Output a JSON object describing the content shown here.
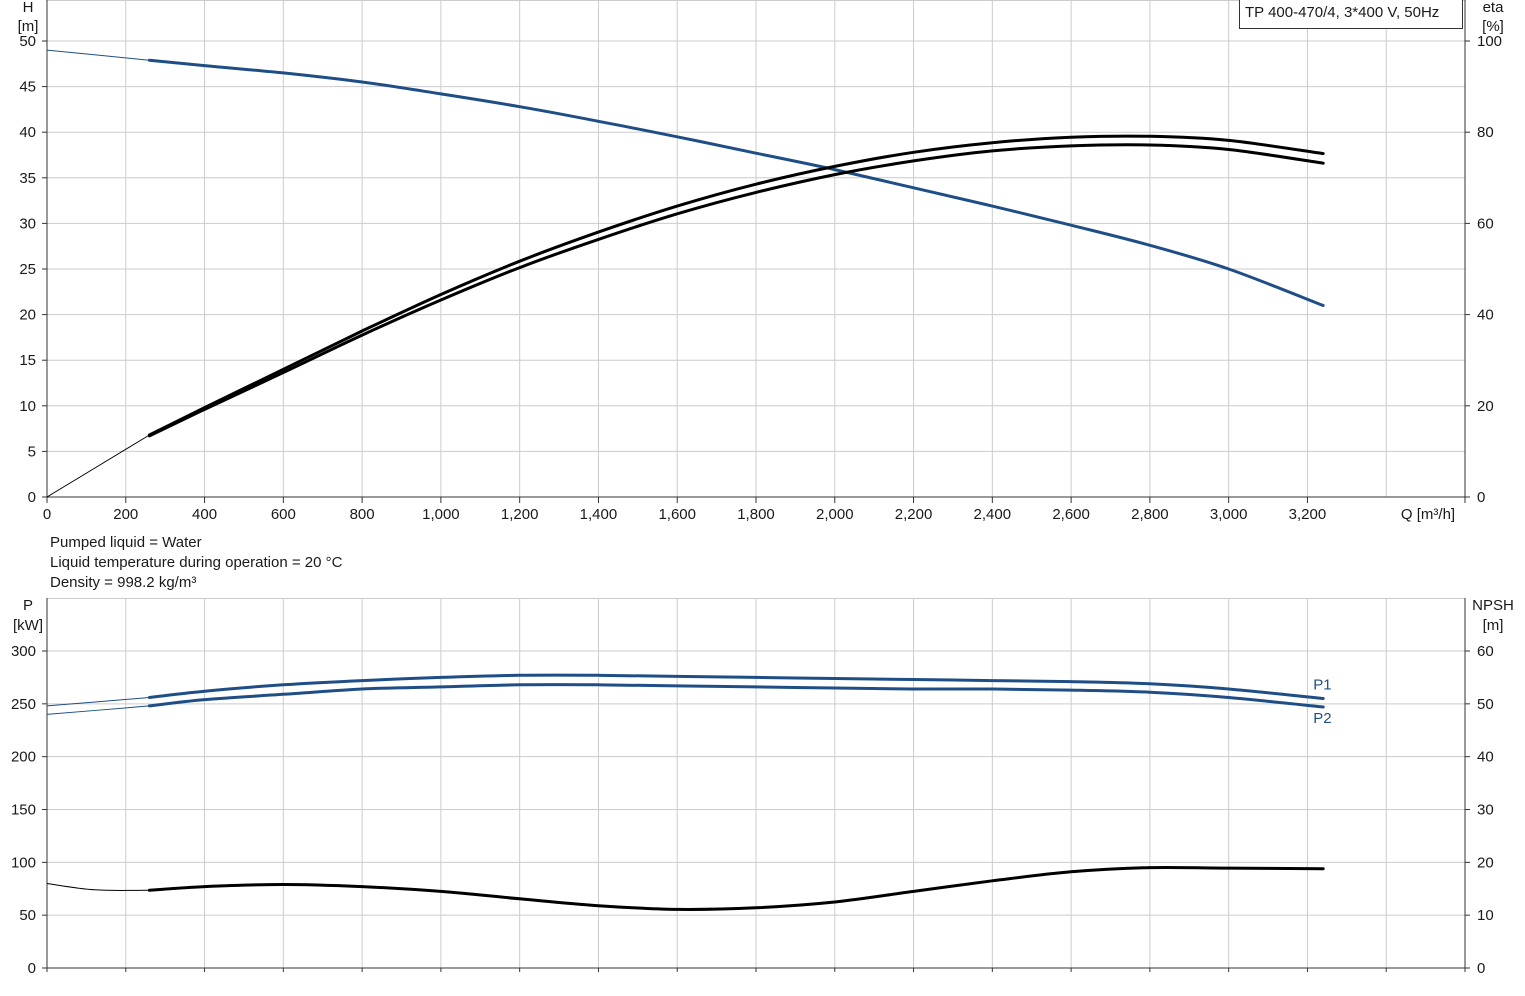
{
  "pump_label": "TP 400-470/4, 3*400 V, 50Hz",
  "liquid_info": [
    "Pumped liquid = Water",
    "Liquid temperature during operation = 20 °C",
    "Density = 998.2 kg/m³"
  ],
  "colors": {
    "blue": "#1f4e86",
    "black": "#000000",
    "grid": "#cccccc"
  },
  "chart_data": [
    {
      "type": "line",
      "xlabel": "Q [m³/h]",
      "xlim": [
        0,
        3600
      ],
      "x_ticks": [
        "0",
        "200",
        "400",
        "600",
        "800",
        "1,000",
        "1,200",
        "1,400",
        "1,600",
        "1,800",
        "2,000",
        "2,200",
        "2,400",
        "2,600",
        "2,800",
        "3,000",
        "3,200"
      ],
      "y_left": {
        "label_line1": "H",
        "label_line2": "[m]",
        "lim": [
          0,
          50
        ],
        "ticks": [
          "0",
          "5",
          "10",
          "15",
          "20",
          "25",
          "30",
          "35",
          "40",
          "45",
          "50"
        ]
      },
      "y_right": {
        "label_line1": "eta",
        "label_line2": "[%]",
        "lim": [
          0,
          100
        ],
        "ticks": [
          "0",
          "20",
          "40",
          "60",
          "80",
          "100"
        ]
      },
      "grid": true,
      "series": [
        {
          "id": "H",
          "axis": "left",
          "color": "#1f4e86",
          "extrapolated": [
            [
              0,
              49.0
            ],
            [
              260,
              47.9
            ]
          ],
          "x": [
            260,
            400,
            600,
            800,
            1000,
            1200,
            1400,
            1600,
            1800,
            2000,
            2200,
            2400,
            2600,
            2800,
            3000,
            3240
          ],
          "y": [
            47.9,
            47.3,
            46.5,
            45.5,
            44.2,
            42.8,
            41.2,
            39.5,
            37.7,
            35.9,
            33.9,
            31.9,
            29.8,
            27.6,
            25.0,
            21.0
          ]
        },
        {
          "id": "eta1",
          "axis": "right",
          "color": "#000000",
          "extrapolated": [
            [
              0,
              0
            ],
            [
              260,
              13.6
            ]
          ],
          "x": [
            260,
            400,
            600,
            800,
            1000,
            1200,
            1400,
            1600,
            1800,
            2000,
            2200,
            2400,
            2600,
            2800,
            3000,
            3240
          ],
          "y": [
            13.6,
            19.6,
            28.0,
            36.4,
            44.4,
            51.7,
            58.1,
            63.8,
            68.6,
            72.5,
            75.6,
            77.7,
            78.9,
            79.1,
            78.2,
            75.3
          ]
        },
        {
          "id": "eta2",
          "axis": "right",
          "color": "#000000",
          "x": [
            260,
            400,
            600,
            800,
            1000,
            1200,
            1400,
            1600,
            1800,
            2000,
            2200,
            2400,
            2600,
            2800,
            3000,
            3240
          ],
          "y": [
            13.4,
            19.2,
            27.3,
            35.5,
            43.2,
            50.3,
            56.5,
            62.1,
            66.8,
            70.7,
            73.7,
            75.9,
            77.0,
            77.2,
            76.2,
            73.2
          ]
        }
      ]
    },
    {
      "type": "line",
      "xlim": [
        0,
        3600
      ],
      "y_left": {
        "label_line1": "P",
        "label_line2": "[kW]",
        "lim": [
          0,
          300
        ],
        "ticks": [
          "0",
          "50",
          "100",
          "150",
          "200",
          "250",
          "300"
        ]
      },
      "y_right": {
        "label_line1": "NPSH",
        "label_line2": "[m]",
        "lim": [
          0,
          60
        ],
        "ticks": [
          "0",
          "10",
          "20",
          "30",
          "40",
          "50",
          "60"
        ]
      },
      "grid": true,
      "series": [
        {
          "id": "P1",
          "name": "P1",
          "axis": "left",
          "color": "#1f4e86",
          "extrapolated": [
            [
              0,
              248
            ],
            [
              260,
              256
            ]
          ],
          "x": [
            260,
            400,
            600,
            800,
            1000,
            1200,
            1400,
            1600,
            1800,
            2000,
            2200,
            2400,
            2600,
            2800,
            3000,
            3240
          ],
          "y": [
            256,
            262,
            268,
            272,
            275,
            277,
            277,
            276,
            275,
            274,
            273,
            272,
            271,
            269,
            264,
            255
          ]
        },
        {
          "id": "P2",
          "name": "P2",
          "axis": "left",
          "color": "#1f4e86",
          "extrapolated": [
            [
              0,
              240
            ],
            [
              260,
              248
            ]
          ],
          "x": [
            260,
            400,
            600,
            800,
            1000,
            1200,
            1400,
            1600,
            1800,
            2000,
            2200,
            2400,
            2600,
            2800,
            3000,
            3240
          ],
          "y": [
            248,
            254,
            259,
            264,
            266,
            268,
            268,
            267,
            266,
            265,
            264,
            264,
            263,
            261,
            256,
            247
          ]
        },
        {
          "id": "NPSH",
          "axis": "right",
          "color": "#000000",
          "extrapolated": [
            [
              0,
              16.0
            ],
            [
              120,
              14.8
            ],
            [
              260,
              14.7
            ]
          ],
          "x": [
            260,
            400,
            600,
            800,
            1000,
            1200,
            1400,
            1600,
            1800,
            2000,
            2200,
            2400,
            2600,
            2800,
            3000,
            3240
          ],
          "y": [
            14.7,
            15.4,
            15.8,
            15.4,
            14.5,
            13.1,
            11.8,
            11.1,
            11.4,
            12.5,
            14.5,
            16.5,
            18.2,
            19.0,
            18.9,
            18.8
          ]
        }
      ]
    }
  ]
}
